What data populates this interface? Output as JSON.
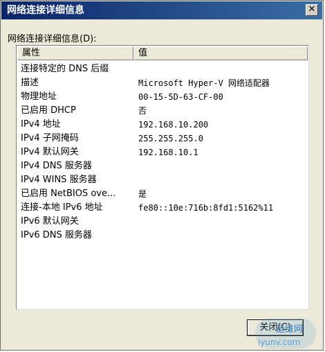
{
  "window": {
    "title": "网络连接详细信息",
    "close_glyph": "✕"
  },
  "group_label": "网络连接详细信息(D):",
  "columns": {
    "property": "属性",
    "value": "值"
  },
  "rows": [
    {
      "property": "连接特定的 DNS 后缀",
      "value": ""
    },
    {
      "property": "描述",
      "value": "Microsoft Hyper-V 网络适配器"
    },
    {
      "property": "物理地址",
      "value": "00-15-5D-63-CF-00"
    },
    {
      "property": "已启用 DHCP",
      "value": "否"
    },
    {
      "property": "IPv4 地址",
      "value": "192.168.10.200"
    },
    {
      "property": "IPv4 子网掩码",
      "value": "255.255.255.0"
    },
    {
      "property": "IPv4 默认网关",
      "value": "192.168.10.1"
    },
    {
      "property": "IPv4 DNS 服务器",
      "value": ""
    },
    {
      "property": "IPv4 WINS 服务器",
      "value": ""
    },
    {
      "property": "已启用 NetBIOS ove...",
      "value": "是"
    },
    {
      "property": "连接-本地 IPv6 地址",
      "value": "fe80::10e:716b:8fd1:5162%11"
    },
    {
      "property": "IPv6 默认网关",
      "value": ""
    },
    {
      "property": "IPv6 DNS 服务器",
      "value": ""
    }
  ],
  "buttons": {
    "close_label": "关闭(C)"
  },
  "watermark": {
    "logo_text": "运维网",
    "site": "iyunv.com"
  },
  "colors": {
    "titlebar_start": "#0a246a",
    "titlebar_end": "#3a6ea5",
    "dialog_bg": "#ece9d8"
  }
}
